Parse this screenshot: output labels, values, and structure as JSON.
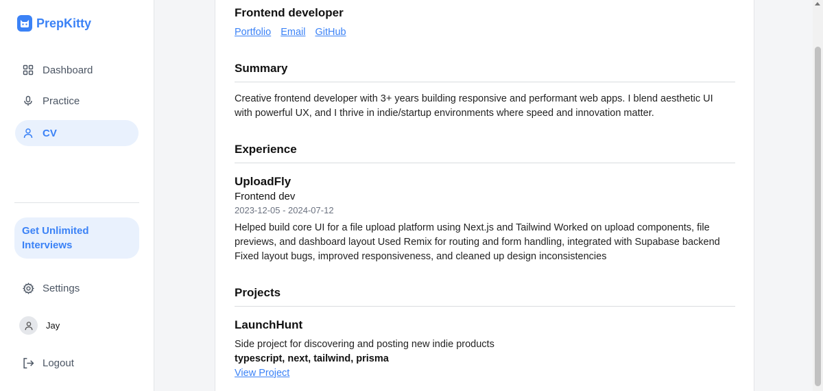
{
  "brand": {
    "name": "PrepKitty",
    "color": "#3b82f6"
  },
  "nav": [
    {
      "label": "Dashboard",
      "icon": "grid-icon"
    },
    {
      "label": "Practice",
      "icon": "microphone-icon"
    },
    {
      "label": "CV",
      "icon": "user-icon",
      "active": true
    }
  ],
  "upgrade": {
    "label": "Get Unlimited Interviews"
  },
  "settings": {
    "label": "Settings",
    "icon": "gear-icon"
  },
  "user": {
    "name": "Jay"
  },
  "logout": {
    "label": "Logout",
    "icon": "logout-icon"
  },
  "cv": {
    "role": "Frontend developer",
    "links": [
      "Portfolio",
      "Email",
      "GitHub"
    ],
    "summary": {
      "title": "Summary",
      "text": "Creative frontend developer with 3+ years building responsive and performant web apps. I blend aesthetic UI with powerful UX, and I thrive in indie/startup environments where speed and innovation matter."
    },
    "experience": {
      "title": "Experience",
      "company": "UploadFly",
      "role": "Frontend dev",
      "dates": "2023-12-05 - 2024-07-12",
      "description": "Helped build core UI for a file upload platform using Next.js and Tailwind Worked on upload components, file previews, and dashboard layout Used Remix for routing and form handling, integrated with Supabase backend Fixed layout bugs, improved responsiveness, and cleaned up design inconsistencies"
    },
    "projects": {
      "title": "Projects",
      "name": "LaunchHunt",
      "description": "Side project for discovering and posting new indie products",
      "tech": "typescript, next, tailwind, prisma",
      "link": "View Project"
    }
  }
}
